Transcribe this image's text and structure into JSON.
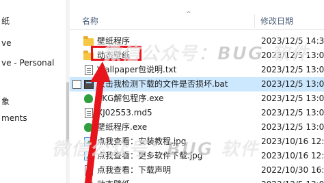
{
  "nav": {
    "items": [
      {
        "label": "纸",
        "icon": "folder-icon"
      },
      {
        "label": "ve",
        "icon": "cloud-icon"
      },
      {
        "label": "ve - Personal",
        "icon": "cloud-icon"
      },
      {
        "label": "象",
        "icon": "image-icon"
      },
      {
        "label": "ments",
        "icon": "document-icon"
      }
    ]
  },
  "header": {
    "name_label": "名称",
    "date_label": "修改日期",
    "sort_indicator": "^"
  },
  "files": [
    {
      "name": "壁纸程序",
      "date": "2023/12/5 14:30",
      "icon": "folder-icon",
      "selected": false
    },
    {
      "name": "动态壁纸",
      "date": "2023/12/5 13:09",
      "icon": "folder-icon",
      "selected": false
    },
    {
      "name": "Wallpaper包说明.txt",
      "date": "2023/12/5 13:09",
      "icon": "text-file-icon",
      "selected": false
    },
    {
      "name": "双击我检测下载的文件是否损坏.bat",
      "date": "2023/12/5 13:09",
      "icon": "batch-file-icon",
      "selected": true
    },
    {
      "name": "PKG解包程序.exe",
      "date": "2023/12/5 13:09",
      "icon": "app-icon",
      "selected": false
    },
    {
      "name": "XJ02553.md5",
      "date": "2023/12/5 13:09",
      "icon": "text-file-icon",
      "selected": false
    },
    {
      "name": "壁纸程序.exe",
      "date": "2023/12/5 13:09",
      "icon": "app-icon",
      "selected": false
    },
    {
      "name": "点我查看：安装教程.jpg",
      "date": "2023/10/16 12:52",
      "icon": "image-file-icon",
      "selected": false
    },
    {
      "name": "点我查看：更多软件下载.jpg",
      "date": "2023/10/16 12:52",
      "icon": "image-file-icon",
      "selected": false
    },
    {
      "name": "点我查看：下载声明",
      "date": "2022/10/30 16:22",
      "icon": "link-icon",
      "selected": false
    },
    {
      "name": "动态壁纸",
      "date": "2023/12/5 13:09",
      "icon": "app-icon",
      "selected": false
    }
  ],
  "overlays": {
    "watermark_text": "微信公众号：BUG 软件",
    "highlight_color": "#e8141c"
  }
}
